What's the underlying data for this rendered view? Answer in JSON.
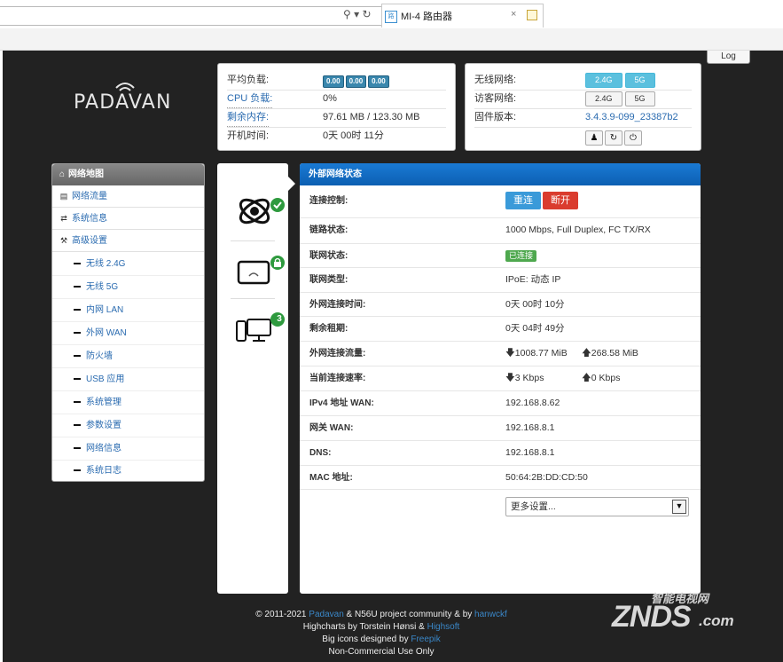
{
  "browser": {
    "tab_title": "MI-4 路由器",
    "tab_close": "×",
    "addr_icons": "⚲ ▾ ↻",
    "favicon_text": "路"
  },
  "header": {
    "log_button": "Log",
    "logo_text": "PADAVAN"
  },
  "status_left": {
    "rows": [
      {
        "label": "平均负载:",
        "value": ""
      },
      {
        "label": "CPU 负载:",
        "value": "0%"
      },
      {
        "label": "剩余内存:",
        "value": "97.61 MB / 123.30 MB"
      },
      {
        "label": "开机时间:",
        "value": "0天 00时 11分"
      }
    ],
    "load_badges": [
      "0.00",
      "0.00",
      "0.00"
    ]
  },
  "status_right": {
    "rows": [
      {
        "label": "无线网络:"
      },
      {
        "label": "访客网络:"
      },
      {
        "label": "固件版本:",
        "value": "3.4.3.9-099_23387b2"
      }
    ],
    "wifi_buttons": [
      "2.4G",
      "5G"
    ],
    "guest_buttons": [
      "2.4G",
      "5G"
    ],
    "action_icons": [
      "user-icon",
      "refresh-icon",
      "power-icon"
    ]
  },
  "sidebar": {
    "header": "网络地图",
    "items": [
      {
        "label": "网络流量",
        "icon": "list-icon"
      },
      {
        "label": "系统信息",
        "icon": "shuffle-icon"
      },
      {
        "label": "高级设置",
        "icon": "wrench-icon"
      }
    ],
    "subitems": [
      "无线 2.4G",
      "无线 5G",
      "内网 LAN",
      "外网 WAN",
      "防火墙",
      "USB 应用",
      "系统管理",
      "参数设置",
      "网络信息",
      "系统日志"
    ]
  },
  "icon_column": {
    "clients_count": "3"
  },
  "main": {
    "title": "外部网络状态",
    "reconnect_label": "重连",
    "disconnect_label": "断开",
    "connected_tag": "已连接",
    "rows": [
      {
        "label": "连接控制:"
      },
      {
        "label": "链路状态:",
        "value": "1000 Mbps, Full Duplex, FC TX/RX"
      },
      {
        "label": "联网状态:"
      },
      {
        "label": "联网类型:",
        "value": "IPoE: 动态 IP"
      },
      {
        "label": "外网连接时间:",
        "value": "0天 00时 10分"
      },
      {
        "label": "剩余租期:",
        "value": "0天 04时 49分"
      },
      {
        "label": "外网连接流量:",
        "down": "1008.77 MiB",
        "up": "268.58 MiB"
      },
      {
        "label": "当前连接速率:",
        "down": "3 Kbps",
        "up": "0 Kbps"
      },
      {
        "label": "IPv4 地址 WAN:",
        "value": "192.168.8.62"
      },
      {
        "label": "网关 WAN:",
        "value": "192.168.8.1"
      },
      {
        "label": "DNS:",
        "value": "192.168.8.1"
      },
      {
        "label": "MAC 地址:",
        "value": "50:64:2B:DD:CD:50"
      }
    ],
    "more_settings": "更多设置..."
  },
  "footer": {
    "line1_pre": "© 2011-2021 ",
    "line1_link1": "Padavan",
    "line1_mid": " & N56U project community & by ",
    "line1_link2": "hanwckf",
    "line2_pre": "Highcharts by Torstein Hønsi & ",
    "line2_link": "Highsoft",
    "line3_pre": "Big icons designed by ",
    "line3_link": "Freepik",
    "line4": "Non-Commercial Use Only"
  },
  "watermark": {
    "top": "智能电视网",
    "main": "ZNDS",
    "suffix": ".com"
  }
}
